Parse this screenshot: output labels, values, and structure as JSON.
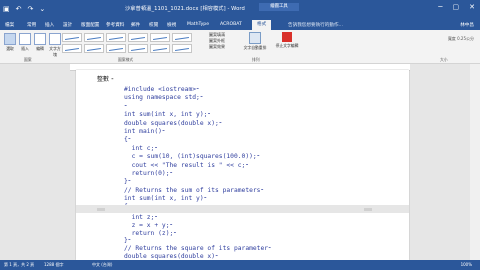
{
  "window": {
    "title": "沙拿普頓溫_1101_1021.docx [相容模式] - Word",
    "context_tab": "繪圖工具",
    "min": "─",
    "max": "▢",
    "close": "✕"
  },
  "qat": {
    "save": "▣",
    "undo": "↶",
    "redo": "↷",
    "more": "⌄"
  },
  "tabs": [
    "檔案",
    "常用",
    "插入",
    "設計",
    "版面配置",
    "參考資料",
    "郵件",
    "校閱",
    "檢視",
    "MathType",
    "ACROBAT",
    "格式"
  ],
  "active_tab": "格式",
  "tell_me": "告訴我您想要執行的動作...",
  "user": "林中昌",
  "share": "共用",
  "ribbon": {
    "buttons": [
      "選取",
      "插入",
      "編輯",
      "文字方塊"
    ],
    "shape_fill": "圖案填滿",
    "shape_outline": "圖案外框",
    "shape_effects": "圖案效果",
    "arrange": [
      "文字自動重排",
      "停止文字編輯"
    ],
    "groups": [
      "圖案",
      "圖案樣式",
      "排列",
      "大小"
    ],
    "size": "寬度 0.25公分"
  },
  "document": {
    "heading": "整數 ⁃",
    "code_lines": [
      "#include <iostream>⁃",
      "using namespace std;⁃",
      "⁃",
      "int sum(int x, int y);⁃",
      "double squares(double x);⁃",
      "int main()⁃",
      "{⁃",
      "  int c;⁃",
      "  c = sum(10, (int)squares(100.0));⁃",
      "  cout << \"The result is \" << c;⁃",
      "  return(0);⁃",
      "}⁃",
      "// Returns the sum of its parameters⁃",
      "int sum(int x, int y)⁃",
      "{⁃"
    ],
    "code_lines_page2": [
      "  int z;⁃",
      "  z = x + y;⁃",
      "  return (z);⁃",
      "}⁃",
      "// Returns the square of its parameter⁃",
      "double squares(double x)⁃"
    ]
  },
  "status": {
    "page": "第 1 頁，共 2 頁",
    "words": "1288 個字",
    "lang": "中文 (台灣)",
    "zoom": "100%"
  }
}
